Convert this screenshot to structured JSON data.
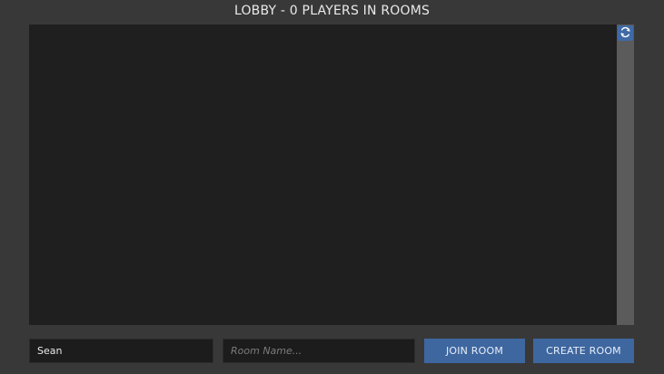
{
  "lobby": {
    "title": "LOBBY - 0 PLAYERS IN ROOMS"
  },
  "room_list": {
    "rooms": []
  },
  "refresh": {
    "icon": "refresh-icon"
  },
  "player_name": {
    "value": "Sean"
  },
  "room_name": {
    "placeholder": "Room Name..."
  },
  "actions": {
    "join_label": "JOIN ROOM",
    "create_label": "CREATE ROOM"
  },
  "colors": {
    "background": "#383838",
    "panel": "#1f1f1f",
    "button": "#3e67a0",
    "scrollbar": "#5b5b5b"
  }
}
